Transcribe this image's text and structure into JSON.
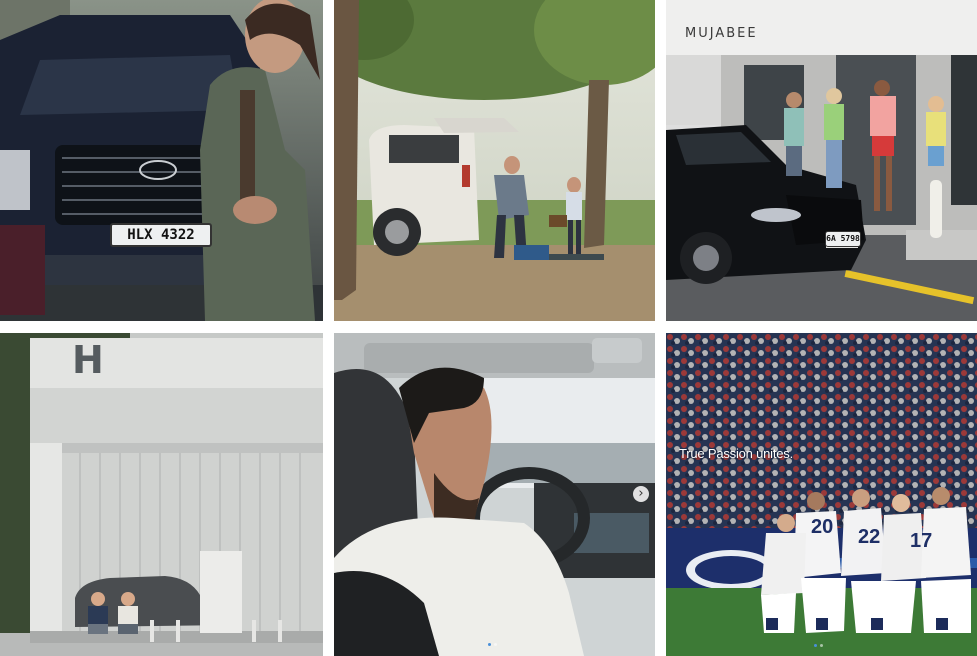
{
  "tiles": [
    {
      "label": "post-palisade-woman",
      "plate": "HLX 4322"
    },
    {
      "label": "post-park-family"
    },
    {
      "label": "post-street-mujabee",
      "shop_sign": "MUJABEE",
      "plate": "6A 5798"
    },
    {
      "label": "post-hydrogen-station",
      "sign": "H"
    },
    {
      "label": "post-driver-carousel"
    },
    {
      "label": "post-soccer-carousel",
      "caption": "True Passion unites."
    }
  ],
  "icons": {
    "next_arrow": "›"
  },
  "colors": {
    "carousel_active_dot": "#4a90d9"
  }
}
